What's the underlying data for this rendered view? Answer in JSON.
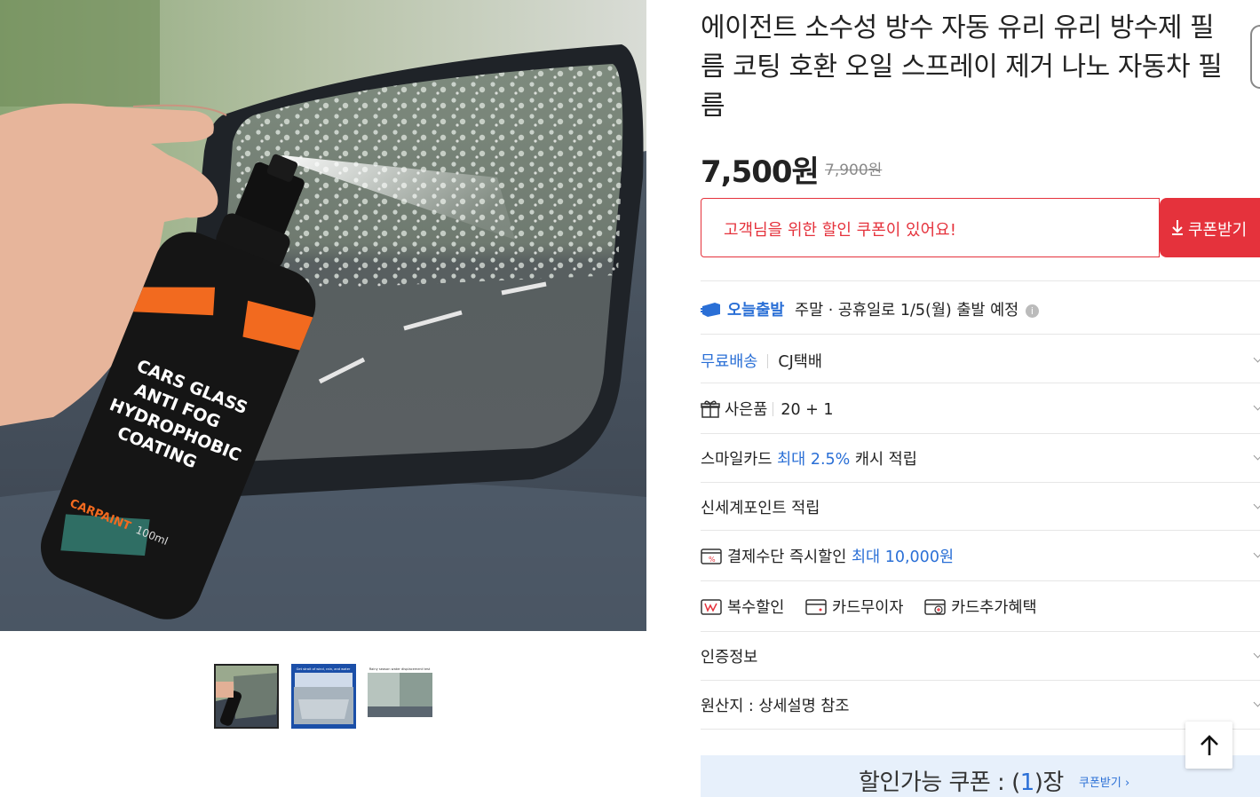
{
  "product": {
    "title": "에이전트 소수성 방수 자동 유리 유리 방수제 필름 코팅 호환 오일 스프레이 제거 나노 자동차 필름",
    "sale_price": "7,500원",
    "original_price": "7,900원"
  },
  "hero_image": {
    "bottle_label_lines": [
      "CARS GLASS",
      "ANTI FOG",
      "HYDROPHOBIC",
      "COATING"
    ],
    "bottle_brand": "CARPAINT",
    "bottle_volume": "100ml"
  },
  "thumbnails": [
    {
      "name": "thumbnail-1",
      "selected": true
    },
    {
      "name": "thumbnail-2",
      "selected": false,
      "caption": "Get strait of wind, rain, and water"
    },
    {
      "name": "thumbnail-3",
      "selected": false,
      "caption": "Rainy season water displacement test"
    }
  ],
  "coupon": {
    "message": "고객님을 위한 할인 쿠폰이 있어요!",
    "button_label": "쿠폰받기"
  },
  "shipping": {
    "badge": "오늘출발",
    "text": "주말 · 공휴일로 1/5(월) 출발 예정"
  },
  "delivery": {
    "free_label": "무료배송",
    "carrier": "CJ택배"
  },
  "gift": {
    "label": "사은품",
    "value": "20 + 1"
  },
  "smile_card": {
    "prefix": "스마일카드",
    "highlight": "최대 2.5%",
    "suffix": "캐시 적립"
  },
  "shinsegae_points": "신세계포인트 적립",
  "payment_discount": {
    "prefix": "결제수단 즉시할인",
    "highlight": "최대 10,000원"
  },
  "benefits": {
    "multi_discount": "복수할인",
    "card_interest_free": "카드무이자",
    "card_extra": "카드추가혜택"
  },
  "certification": "인증정보",
  "origin": "원산지 : 상세설명 참조",
  "coupon_banner": {
    "prefix": "할인가능 쿠폰 : (",
    "count": "1",
    "suffix": ")장",
    "link": "쿠폰받기 ›"
  },
  "colors": {
    "accent_red": "#e5323c",
    "accent_blue": "#2a6fd6",
    "banner_bg": "#e7f0fb"
  }
}
